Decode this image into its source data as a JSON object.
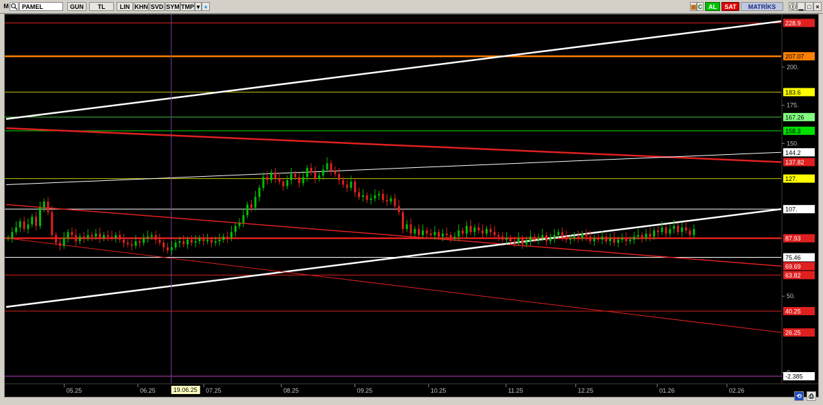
{
  "toolbar": {
    "logo": "M",
    "symbol": "PAMEL",
    "buttons": [
      "GUN",
      "TL",
      "LIN",
      "KHN",
      "SVD",
      "SYM",
      "TMP"
    ],
    "right_buttons": {
      "al": "AL",
      "sat": "SAT",
      "brand": "MATRİKS"
    }
  },
  "colors": {
    "background": "#000000",
    "up": "#00c000",
    "down": "#e02020",
    "white_line": "#ffffff"
  },
  "chart_data": {
    "type": "candlestick",
    "title": "",
    "ylim": [
      -2.385,
      230
    ],
    "y_ticks": [
      {
        "value": 200,
        "label": "200."
      },
      {
        "value": 175,
        "label": "175."
      },
      {
        "value": 150,
        "label": "150."
      },
      {
        "value": 50,
        "label": "50."
      },
      {
        "value": 0,
        "label": "0"
      }
    ],
    "x_ticks": [
      "05.25",
      "06.25",
      "07.25",
      "08.25",
      "09.25",
      "10.25",
      "11.25",
      "12.25",
      "01.26",
      "02.26"
    ],
    "cursor_date": "19.06.25",
    "price_levels": [
      {
        "value": 228.9,
        "label": "228.9",
        "color": "#e02020",
        "tag_bg": "#e02020",
        "tag_fg": "#ffffff"
      },
      {
        "value": 207.07,
        "label": "207.07",
        "color": "#ff8000",
        "tag_bg": "#ff8000",
        "tag_fg": "#000000"
      },
      {
        "value": 183.6,
        "label": "183.6",
        "color": "#c8c800",
        "tag_bg": "#ffff00",
        "tag_fg": "#000000"
      },
      {
        "value": 167.26,
        "label": "167.26",
        "color": "#40c040",
        "tag_bg": "#80ff80",
        "tag_fg": "#000000"
      },
      {
        "value": 158.3,
        "label": "158.3",
        "color": "#00e000",
        "tag_bg": "#00e000",
        "tag_fg": "#000000"
      },
      {
        "value": 144.2,
        "label": "144.2",
        "color": null,
        "tag_bg": "#ffffff",
        "tag_fg": "#000000"
      },
      {
        "value": 137.82,
        "label": "137.82",
        "color": null,
        "tag_bg": "#e02020",
        "tag_fg": "#ffffff"
      },
      {
        "value": 127,
        "label": "127.",
        "color": "#c8c800",
        "tag_bg": "#ffff00",
        "tag_fg": "#000000"
      },
      {
        "value": 107,
        "label": "107.",
        "color": "#ffffff",
        "tag_bg": "#ffffff",
        "tag_fg": "#000000"
      },
      {
        "value": 87.93,
        "label": "87.93",
        "color": "#e02020",
        "tag_bg": "#e02020",
        "tag_fg": "#ffffff"
      },
      {
        "value": 75.46,
        "label": "75.46",
        "color": "#ffffff",
        "tag_bg": "#ffffff",
        "tag_fg": "#000000"
      },
      {
        "value": 69.69,
        "label": "69.69",
        "color": null,
        "tag_bg": "#e02020",
        "tag_fg": "#ffffff"
      },
      {
        "value": 63.82,
        "label": "63.82",
        "color": "#e02020",
        "tag_bg": "#e02020",
        "tag_fg": "#ffffff"
      },
      {
        "value": 40.25,
        "label": "40.25",
        "color": "#e02020",
        "tag_bg": "#e02020",
        "tag_fg": "#ffffff"
      },
      {
        "value": 26.25,
        "label": "26.25",
        "color": null,
        "tag_bg": "#e02020",
        "tag_fg": "#ffffff"
      },
      {
        "value": -2.385,
        "label": "-2.385",
        "color": "#c040c0",
        "tag_bg": "#ffffff",
        "tag_fg": "#000000"
      }
    ],
    "trend_lines": [
      {
        "from": [
          0,
          166
        ],
        "to": [
          1,
          230
        ],
        "color": "#ffffff",
        "width": 2.5
      },
      {
        "from": [
          0,
          160
        ],
        "to": [
          1,
          137.82
        ],
        "color": "#e02020",
        "width": 2.5
      },
      {
        "from": [
          0,
          123
        ],
        "to": [
          1,
          144.2
        ],
        "color": "#ffffff",
        "width": 1
      },
      {
        "from": [
          0,
          110
        ],
        "to": [
          1,
          69.69
        ],
        "color": "#e02020",
        "width": 1.5
      },
      {
        "from": [
          0,
          43
        ],
        "to": [
          1,
          107
        ],
        "color": "#ffffff",
        "width": 2.5
      },
      {
        "from": [
          0,
          88
        ],
        "to": [
          1,
          26.25
        ],
        "color": "#e02020",
        "width": 1
      }
    ],
    "candles": [
      88,
      92,
      95,
      99,
      94,
      97,
      102,
      96,
      108,
      112,
      105,
      90,
      85,
      83,
      88,
      92,
      90,
      86,
      89,
      88,
      90,
      89,
      91,
      88,
      90,
      89,
      88,
      90,
      87,
      85,
      84,
      83,
      86,
      85,
      88,
      89,
      90,
      87,
      85,
      82,
      80,
      82,
      85,
      86,
      84,
      87,
      85,
      86,
      88,
      86,
      87,
      85,
      86,
      87,
      89,
      88,
      92,
      96,
      98,
      103,
      110,
      108,
      115,
      121,
      128,
      126,
      131,
      127,
      125,
      122,
      126,
      130,
      128,
      124,
      128,
      134,
      131,
      127,
      129,
      133,
      137,
      132,
      130,
      126,
      123,
      121,
      125,
      118,
      115,
      116,
      113,
      114,
      116,
      117,
      113,
      112,
      114,
      109,
      105,
      94,
      97,
      91,
      94,
      90,
      93,
      91,
      90,
      92,
      89,
      91,
      90,
      88,
      89,
      93,
      91,
      96,
      92,
      95,
      93,
      91,
      94,
      92,
      90,
      89,
      87,
      88,
      86,
      85,
      88,
      84,
      86,
      89,
      87,
      88,
      90,
      86,
      88,
      90,
      92,
      89,
      87,
      88,
      89,
      88,
      91,
      89,
      86,
      88,
      87,
      89,
      86,
      88,
      85,
      87,
      88,
      86,
      87,
      89,
      90,
      88,
      91,
      89,
      93,
      92,
      95,
      91,
      94,
      96,
      92,
      95,
      93,
      90,
      94
    ],
    "data_labels": {
      "note": ""
    }
  },
  "bottom": {
    "scroll_icon": "scroll-sync-icon",
    "print_icon": "printer-icon"
  }
}
